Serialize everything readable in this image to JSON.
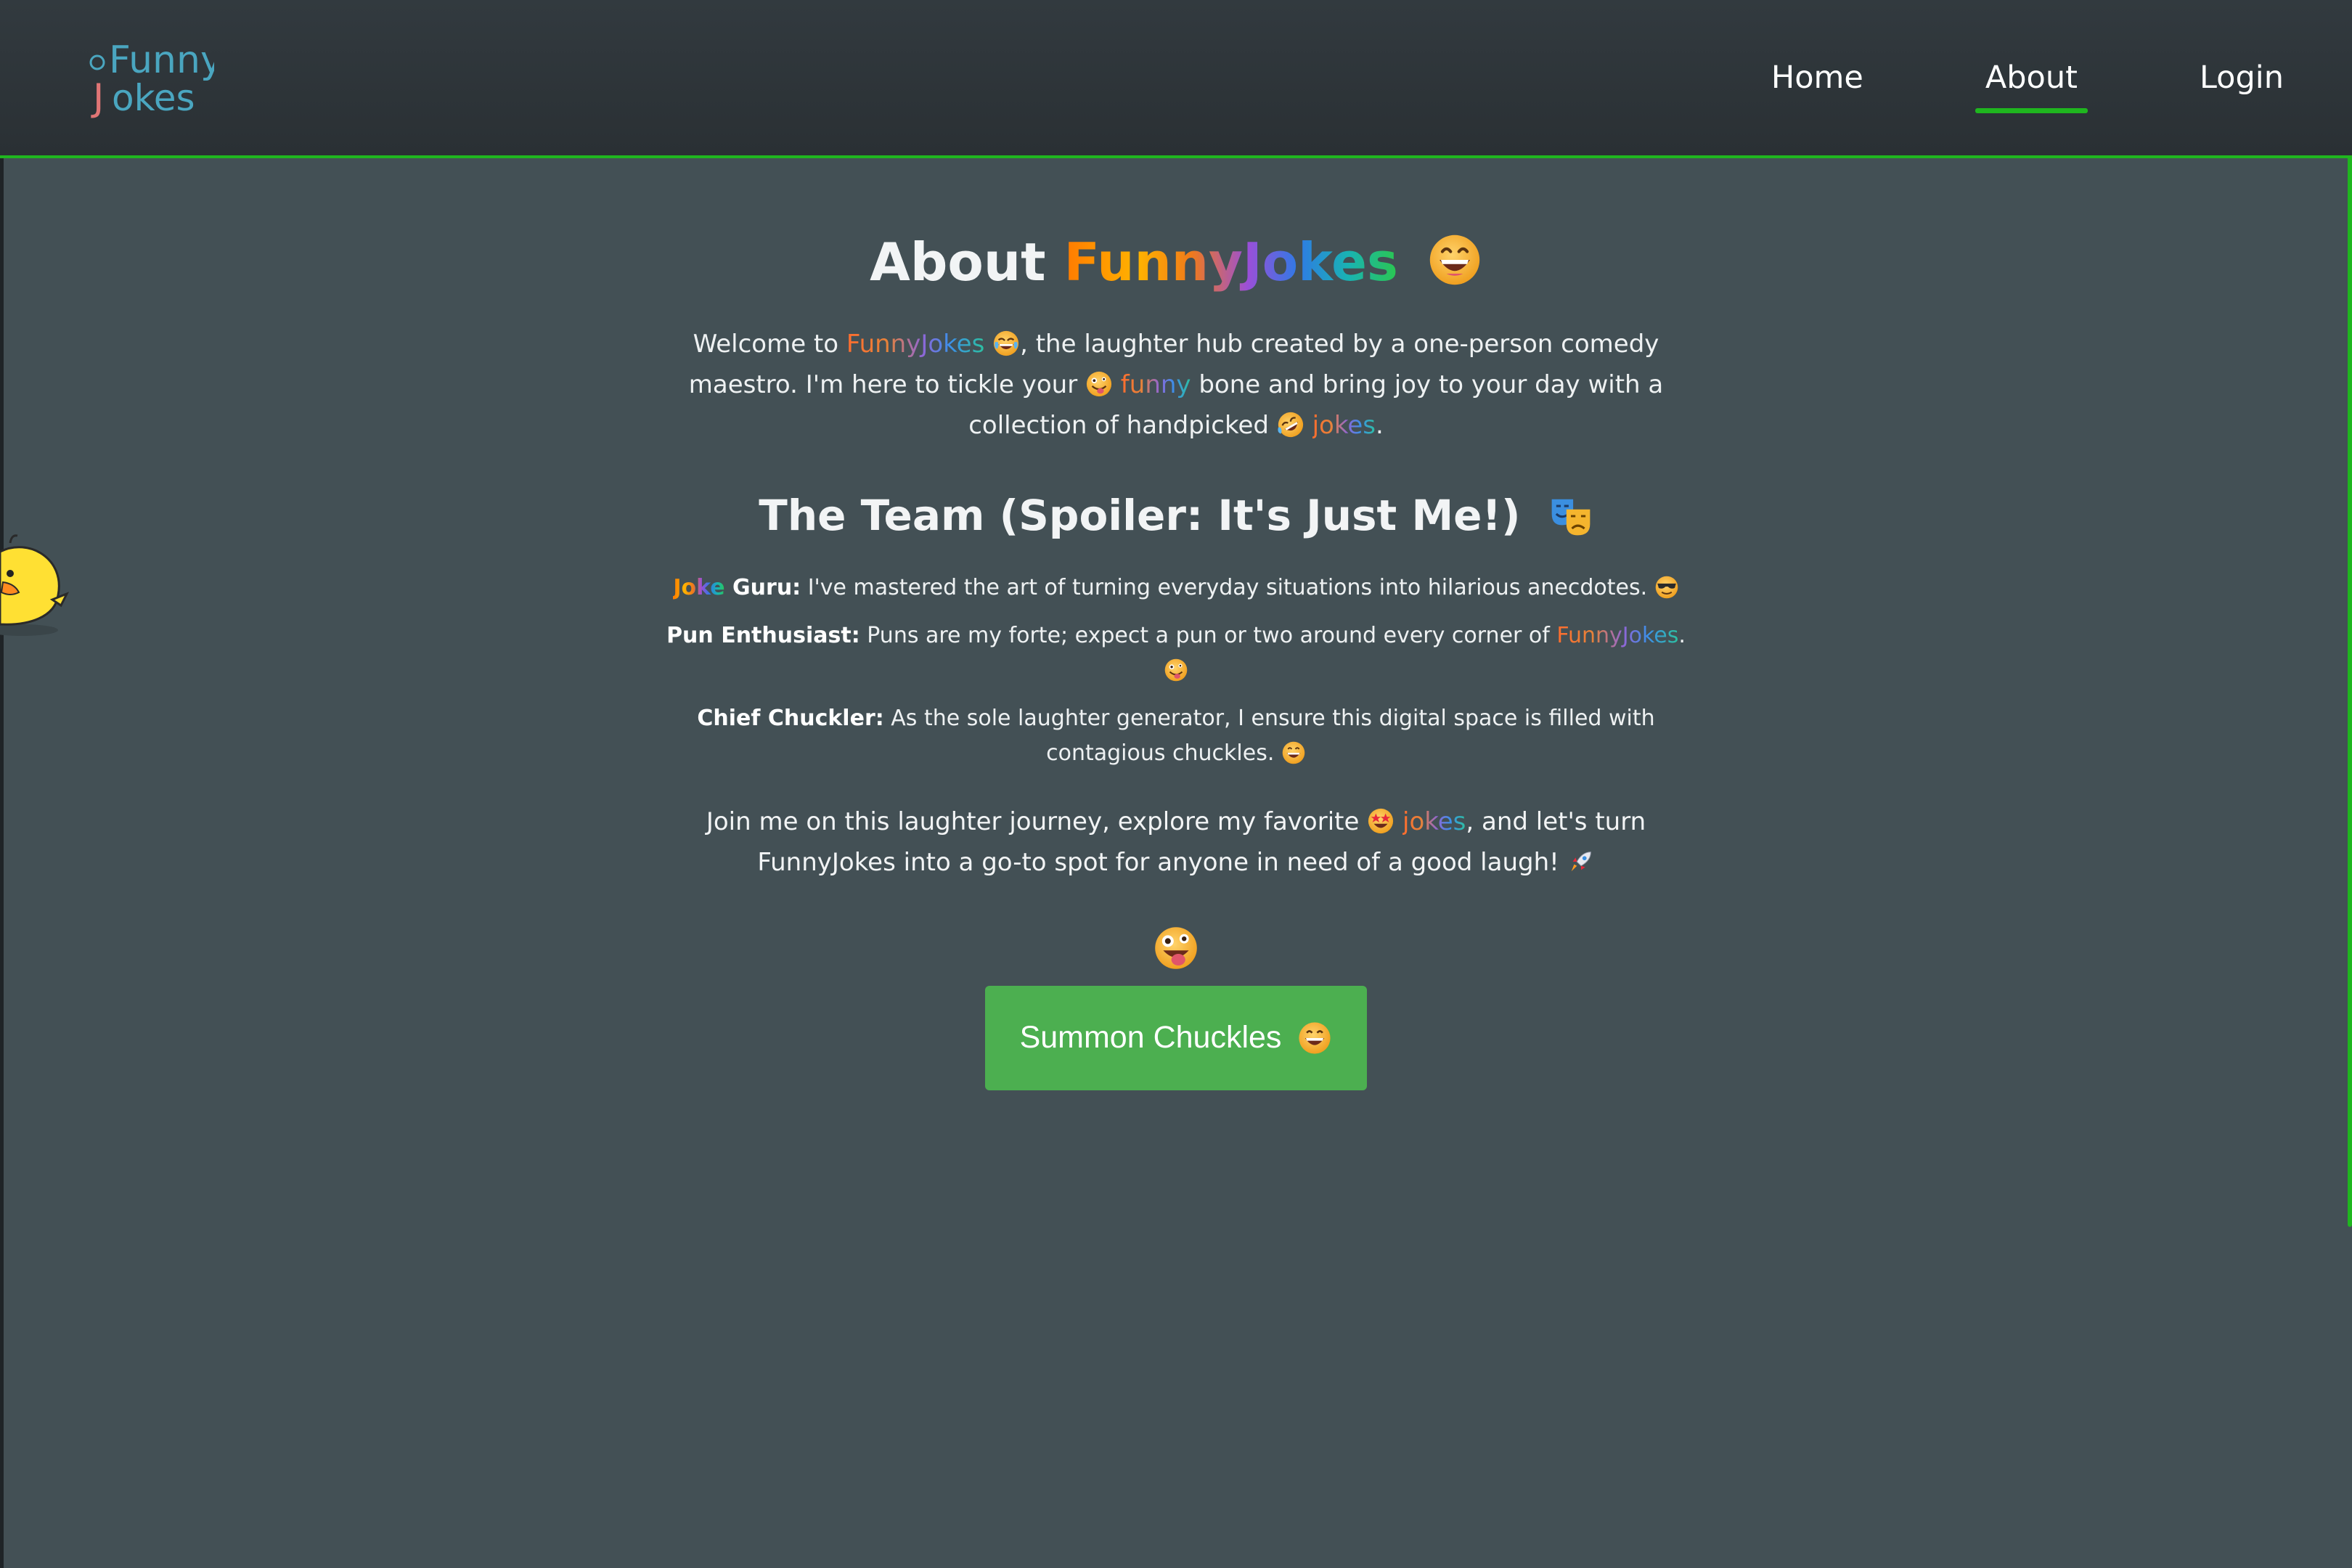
{
  "brand": {
    "logo_line1": "Funny",
    "logo_line2": "Jokes"
  },
  "nav": {
    "items": [
      {
        "label": "Home",
        "active": false
      },
      {
        "label": "About",
        "active": true
      },
      {
        "label": "Login",
        "active": false
      }
    ]
  },
  "header": {
    "title_prefix": "About ",
    "title_brand": "FunnyJokes"
  },
  "intro": {
    "part1": "Welcome to ",
    "brand": "FunnyJokes",
    "part2": ", the laughter hub created by a one-person comedy maestro. I'm here to tickle your ",
    "funny": "funny",
    "part3": " bone and bring joy to your day with a collection of handpicked ",
    "jokes": "jokes",
    "part4": "."
  },
  "team": {
    "heading": "The Team (Spoiler: It's Just Me!)",
    "members": [
      {
        "role_colored": "Joke",
        "role_rest": " Guru:",
        "text": " I've mastered the art of turning everyday situations into hilarious anecdotes. "
      },
      {
        "role": "Pun Enthusiast:",
        "text": " Puns are my forte; expect a pun or two around every corner of ",
        "brand": "FunnyJokes",
        "tail": ". "
      },
      {
        "role": "Chief Chuckler:",
        "text": " As the sole laughter generator, I ensure this digital space is filled with contagious chuckles. "
      }
    ]
  },
  "closing": {
    "part1": "Join me on this laughter journey, explore my favorite ",
    "jokes": "jokes",
    "part2": ", and let's turn FunnyJokes into a go-to spot for anyone in need of a good laugh! "
  },
  "cta": {
    "label": "Summon Chuckles"
  },
  "colors": {
    "accent": "#1fb61f",
    "button": "#4caf50",
    "background": "#435055",
    "navbar": "#2e353a"
  },
  "icons": [
    "grinning-emoji",
    "joy-emoji",
    "zany-emoji",
    "rofl-emoji",
    "theater-masks-emoji",
    "sunglasses-emoji",
    "star-struck-emoji",
    "rocket-emoji",
    "mascot-chick"
  ]
}
